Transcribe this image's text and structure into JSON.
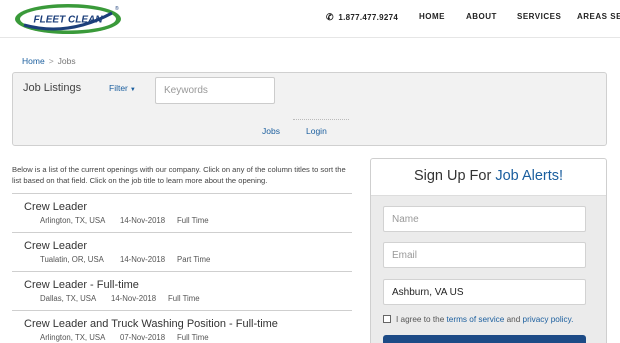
{
  "brand": {
    "logo_text": "FLEET CLEAN",
    "logo_mark": "®",
    "green": "#3a9a3a",
    "navy": "#1c3f7a"
  },
  "header": {
    "phone": "1.877.477.9274",
    "nav": [
      "HOME",
      "ABOUT",
      "SERVICES",
      "AREAS SERV"
    ]
  },
  "breadcrumb": {
    "home": "Home",
    "separator": ">",
    "current": "Jobs"
  },
  "search": {
    "title": "Job Listings",
    "filter_label": "Filter",
    "keywords_placeholder": "Keywords",
    "tabs": [
      "Jobs",
      "Login"
    ]
  },
  "intro": "Below is a list of the current openings with our company. Click on any of the column titles to sort the list based on that field. Click on the job title to learn more about the opening.",
  "jobs": [
    {
      "title": "Crew Leader",
      "location": "Arlington, TX, USA",
      "date": "14-Nov-2018",
      "type": "Full Time"
    },
    {
      "title": "Crew Leader",
      "location": "Tualatin, OR, USA",
      "date": "14-Nov-2018",
      "type": "Part Time"
    },
    {
      "title": "Crew Leader - Full-time",
      "location": "Dallas, TX, USA",
      "date": "14-Nov-2018",
      "type": "Full Time"
    },
    {
      "title": "Crew Leader and Truck Washing Position - Full-time",
      "location": "Arlington, TX, USA",
      "date": "07-Nov-2018",
      "type": "Full Time"
    }
  ],
  "alerts": {
    "heading_prefix": "Sign Up For",
    "heading_highlight": "Job Alerts!",
    "name_placeholder": "Name",
    "email_placeholder": "Email",
    "location_value": "Ashburn, VA US",
    "agree_prefix": "I agree to the",
    "terms_link": "terms of service",
    "and_text": "and",
    "privacy_link": "privacy policy."
  },
  "colors": {
    "link": "#1a5e9e",
    "button": "#1d4b86",
    "panel_bg": "#f2f2f2"
  }
}
